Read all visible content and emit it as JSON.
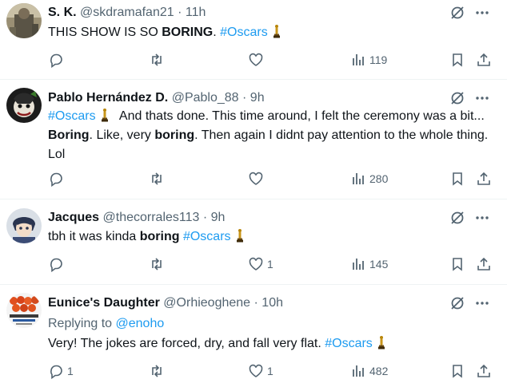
{
  "tweets": [
    {
      "name": "S. K.",
      "handle": "@skdramafan21",
      "sep": "·",
      "time": "11h",
      "text_parts": [
        "THIS SHOW IS SO ",
        "BORING",
        ". ",
        "#Oscars"
      ],
      "reply_count": "",
      "retweet_count": "",
      "like_count": "",
      "view_count": "119",
      "avatar_icon": "photo-avatar"
    },
    {
      "name": "Pablo Hernández D.",
      "handle": "@Pablo_88",
      "sep": "·",
      "time": "9h",
      "text_parts": [
        "#Oscars",
        "And thats done. This time around, I felt the ceremony was a bit... ",
        "Boring",
        ". Like, very ",
        "boring",
        ". Then again I didnt pay attention to the whole thing. Lol"
      ],
      "reply_count": "",
      "retweet_count": "",
      "like_count": "",
      "view_count": "280",
      "avatar_icon": "photo-avatar"
    },
    {
      "name": "Jacques",
      "handle": "@thecorrales113",
      "sep": "·",
      "time": "9h",
      "text_parts": [
        "tbh it was kinda ",
        "boring",
        " ",
        "#Oscars"
      ],
      "reply_count": "",
      "retweet_count": "",
      "like_count": "1",
      "view_count": "145",
      "avatar_icon": "anime-avatar"
    },
    {
      "name": "Eunice's Daughter",
      "handle": "@Orhieoghene",
      "sep": "·",
      "time": "10h",
      "replying_label": "Replying to",
      "replying_to": "@enoho",
      "text_parts": [
        "Very! The jokes are forced, dry, and fall very flat. ",
        "#Oscars"
      ],
      "reply_count": "1",
      "retweet_count": "",
      "like_count": "1",
      "view_count": "482",
      "avatar_icon": "food-avatar"
    }
  ],
  "icons": {
    "reply": "reply-icon",
    "retweet": "retweet-icon",
    "like": "like-icon",
    "views": "views-icon",
    "bookmark": "bookmark-icon",
    "share": "share-icon",
    "grok": "grok-icon",
    "more": "more-icon",
    "trophy": "oscar-trophy-emoji"
  },
  "colors": {
    "hashtag": "#1d9bf0",
    "secondary_text": "#536471",
    "primary_text": "#0f1419",
    "divider": "#eff3f4"
  }
}
